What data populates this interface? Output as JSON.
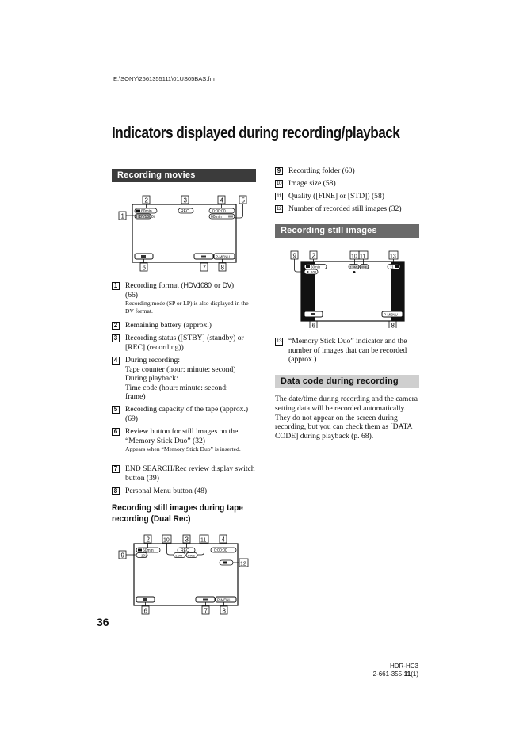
{
  "header": {
    "file_path": "E:\\SONY\\2661355111\\01US05BAS.fm",
    "page_title": "Indicators displayed during recording/playback"
  },
  "recording_movies": {
    "section_title": "Recording movies",
    "diagram": {
      "callouts": [
        "1",
        "2",
        "3",
        "4",
        "5",
        "6",
        "7",
        "8"
      ],
      "screen": {
        "battery": "60min",
        "format": "HDV1080i",
        "status": "REC",
        "counter": "0:00:00",
        "tape_remaining": "60min",
        "review_button": "review",
        "end_search_button": "end-search",
        "menu_button": "P-MENU"
      }
    },
    "items": [
      {
        "num": "1",
        "text_before": "Recording format (",
        "hdv": "HDV1080i",
        "or": " or ",
        "dv": "DV",
        "text_after": ")",
        "line2": "(66)",
        "sub": "Recording mode (SP or LP) is also displayed in the DV format."
      },
      {
        "num": "2",
        "text": "Remaining battery (approx.)"
      },
      {
        "num": "3",
        "text": "Recording status ([STBY] (standby) or [REC] (recording))"
      },
      {
        "num": "4",
        "lines": [
          "During recording:",
          "Tape counter (hour: minute: second)",
          "During playback:",
          "Time code (hour: minute: second:",
          "frame)"
        ]
      },
      {
        "num": "5",
        "text": "Recording capacity of the tape (approx.) (69)"
      },
      {
        "num": "6",
        "text": "Review button for still images on the “Memory Stick Duo” (32)",
        "sub": "Appears when “Memory Stick Duo” is inserted."
      },
      {
        "num": "7",
        "text": "END SEARCH/Rec review display switch button (39)"
      },
      {
        "num": "8",
        "text": "Personal Menu button (48)"
      }
    ]
  },
  "dual_rec": {
    "subheading": "Recording still images during tape recording (Dual Rec)",
    "diagram": {
      "callouts": [
        "2",
        "10",
        "3",
        "11",
        "4",
        "9",
        "12",
        "6",
        "7",
        "8"
      ],
      "screen": {
        "battery": "60min",
        "folder": "101",
        "status": "REC",
        "size": "1.9M",
        "quality": "FINE",
        "counter": "0:00:00",
        "menu_button": "P-MENU"
      }
    }
  },
  "right_items": [
    {
      "num": "9",
      "text": "Recording folder (60)"
    },
    {
      "num": "10",
      "text": "Image size (58)"
    },
    {
      "num": "11",
      "text": "Quality ([FINE] or [STD]) (58)"
    },
    {
      "num": "12",
      "text": "Number of recorded still images (32)"
    }
  ],
  "recording_still_images": {
    "section_title": "Recording still images",
    "diagram": {
      "callouts": [
        "9",
        "2",
        "10",
        "11",
        "13",
        "6",
        "8"
      ],
      "screen": {
        "battery": "60min",
        "folder": "101",
        "size": "1.9M",
        "quality": "FINE",
        "remaining": "11",
        "menu_button": "P-MENU"
      }
    },
    "items": [
      {
        "num": "13",
        "text": "“Memory Stick Duo” indicator and the number of images that can be recorded (approx.)"
      }
    ]
  },
  "data_code": {
    "section_title": "Data code during recording",
    "paragraph": "The date/time during recording and the camera setting data will be recorded automatically. They do not appear on the screen during recording, but you can check them as [DATA CODE] during playback (p. 68)."
  },
  "footer": {
    "page_number": "36",
    "model": "HDR-HC3",
    "part_number_prefix": "2-661-355-",
    "part_number_bold": "11",
    "part_number_suffix": "(1)"
  }
}
